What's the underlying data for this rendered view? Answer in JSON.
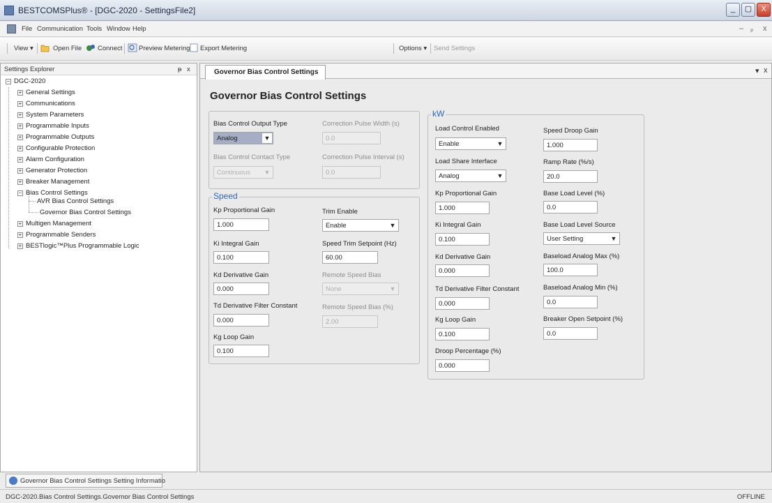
{
  "window": {
    "title": "BESTCOMSPlus® - [DGC-2020 - SettingsFile2]",
    "minimize": "_",
    "restore": "▢",
    "close": "X"
  },
  "menu": {
    "items": [
      "File",
      "Communication",
      "Tools",
      "Window",
      "Help"
    ],
    "mdi_min": "–",
    "mdi_restore": "ₚ",
    "mdi_close": "x"
  },
  "toolbar": {
    "view": "View ▾",
    "open_file": "Open File",
    "connect": "Connect",
    "preview_metering": "Preview Metering",
    "export_metering": "Export Metering",
    "options": "Options ▾",
    "send_settings": "Send Settings"
  },
  "explorer": {
    "title": "Settings Explorer",
    "pin": "ᵽ",
    "close": "x",
    "root": "DGC-2020",
    "items": [
      "General Settings",
      "Communications",
      "System Parameters",
      "Programmable Inputs",
      "Programmable Outputs",
      "Configurable Protection",
      "Alarm Configuration",
      "Generator Protection",
      "Breaker Management",
      "Bias Control Settings",
      "AVR Bias Control Settings",
      "Governor Bias Control Settings",
      "Multigen Management",
      "Programmable Senders",
      "BESTlogic™Plus Programmable Logic"
    ]
  },
  "tab": {
    "label": "Governor Bias Control Settings",
    "dropdown": "▾",
    "close": "x"
  },
  "page": {
    "title": "Governor Bias Control Settings",
    "bias": {
      "output_type_label": "Bias Control Output Type",
      "output_type_value": "Analog",
      "contact_type_label": "Bias Control Contact Type",
      "contact_type_value": "Continuous",
      "pulse_width_label": "Correction Pulse Width (s)",
      "pulse_width_value": "0.0",
      "pulse_interval_label": "Correction Pulse Interval (s)",
      "pulse_interval_value": "0.0"
    },
    "speed": {
      "title": "Speed",
      "kp_label": "Kp Proportional Gain",
      "kp_value": "1.000",
      "ki_label": "Ki Integral Gain",
      "ki_value": "0.100",
      "kd_label": "Kd Derivative Gain",
      "kd_value": "0.000",
      "td_label": "Td Derivative Filter Constant",
      "td_value": "0.000",
      "kg_label": "Kg Loop Gain",
      "kg_value": "0.100",
      "trim_enable_label": "Trim Enable",
      "trim_enable_value": "Enable",
      "trim_setpoint_label": "Speed Trim Setpoint (Hz)",
      "trim_setpoint_value": "60.00",
      "remote_bias_label": "Remote Speed Bias",
      "remote_bias_value": "None",
      "remote_bias_pct_label": "Remote Speed Bias (%)",
      "remote_bias_pct_value": "2.00"
    },
    "kw": {
      "title": "kW",
      "load_control_label": "Load Control Enabled",
      "load_control_value": "Enable",
      "load_share_label": "Load Share Interface",
      "load_share_value": "Analog",
      "kp_label": "Kp Proportional Gain",
      "kp_value": "1.000",
      "ki_label": "Ki Integral Gain",
      "ki_value": "0.100",
      "kd_label": "Kd Derivative Gain",
      "kd_value": "0.000",
      "td_label": "Td Derivative Filter Constant",
      "td_value": "0.000",
      "kg_label": "Kg Loop Gain",
      "kg_value": "0.100",
      "droop_pct_label": "Droop Percentage (%)",
      "droop_pct_value": "0.000",
      "droop_gain_label": "Speed Droop Gain",
      "droop_gain_value": "1.000",
      "ramp_rate_label": "Ramp Rate (%/s)",
      "ramp_rate_value": "20.0",
      "base_load_label": "Base Load Level (%)",
      "base_load_value": "0.0",
      "base_load_source_label": "Base Load Level Source",
      "base_load_source_value": "User Setting",
      "analog_max_label": "Baseload Analog Max (%)",
      "analog_max_value": "100.0",
      "analog_min_label": "Baseload Analog Min (%)",
      "analog_min_value": "0.0",
      "breaker_open_label": "Breaker Open Setpoint (%)",
      "breaker_open_value": "0.0"
    }
  },
  "bottom_tab": {
    "label": "Governor Bias Control Settings Setting Informatio"
  },
  "status": {
    "path": "DGC-2020.Bias Control Settings.Governor Bias Control Settings",
    "offline": "OFFLINE"
  },
  "colors": {
    "accent_group_title": "#2a68b8",
    "selected_dropdown": "#a5aec4"
  }
}
